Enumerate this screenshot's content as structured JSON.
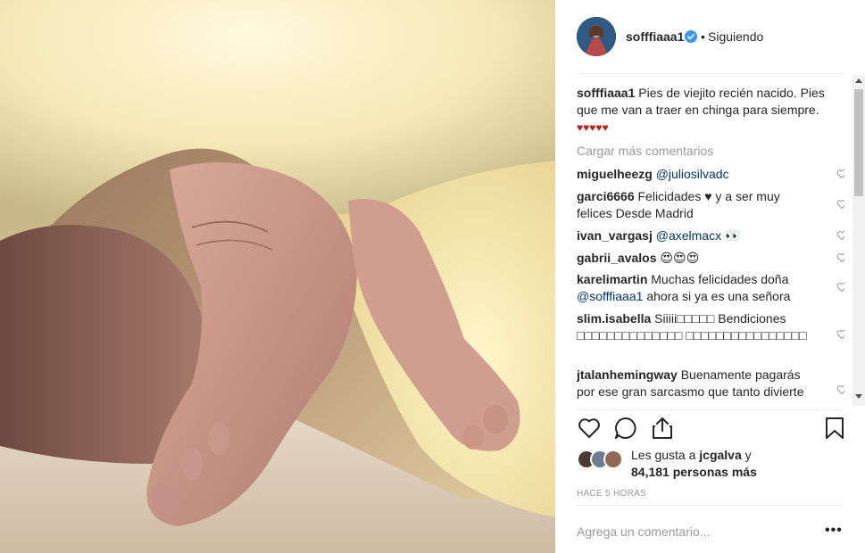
{
  "header": {
    "username": "sofffiaaa1",
    "separator": "•",
    "follow_status": "Siguiendo",
    "verified_icon": "verified-badge-icon",
    "accent_color": "#3897f0"
  },
  "caption": {
    "username": "sofffiaaa1",
    "text": "Pies de viejito recién nacido. Pies que me van a traer en chinga para siempre.",
    "emoji": "♥♥♥♥♥"
  },
  "load_more": "Cargar más comentarios",
  "comments": [
    {
      "user": "miguelheezg",
      "mention": "@juliosilvadc",
      "text": ""
    },
    {
      "user": "garci6666",
      "text": "Felicidades ♥ y a ser muy felices Desde Madrid"
    },
    {
      "user": "ivan_vargasj",
      "mention": "@axelmacx",
      "text": "👀"
    },
    {
      "user": "gabrii_avalos",
      "text": "😍😍😍"
    },
    {
      "user": "karelimartin",
      "text": "Muchas felicidades doña",
      "mention": "@sofffiaaa1",
      "text2": "ahora si ya es una señora"
    },
    {
      "user": "slim.isabella",
      "text": "Siiiii□□□□□ Bendiciones □□□□□□□□□□□□□□ □□□□□□□□□□□□□□□□"
    },
    {
      "user": "jtalanhemingway",
      "text": "Buenamente pagarás por ese gran sarcasmo que tanto divierte"
    }
  ],
  "likes": {
    "line1": "Les gusta a",
    "user": "jcgalva",
    "line1_end": "y",
    "line2": "84,181 personas más"
  },
  "timestamp": "HACE 5 HORAS",
  "comment_input": {
    "placeholder": "Agrega un comentario..."
  },
  "more_options": "•••",
  "icons": [
    "heart-icon",
    "comment-icon",
    "share-icon",
    "bookmark-icon",
    "more-options-icon"
  ]
}
